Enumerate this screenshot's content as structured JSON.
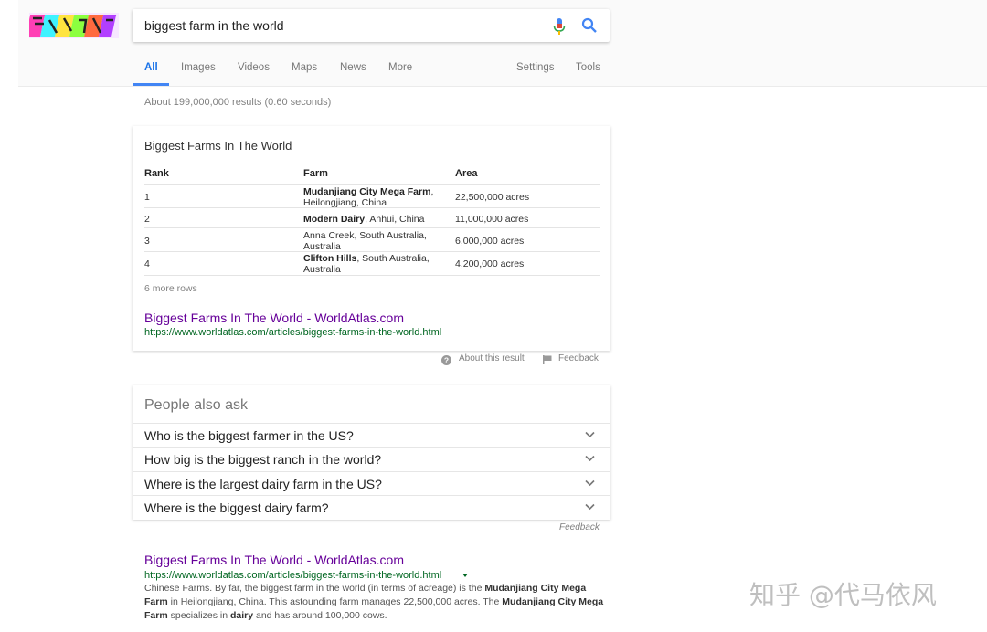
{
  "search": {
    "query": "biggest farm in the world"
  },
  "tabs": [
    {
      "label": "All"
    },
    {
      "label": "Images"
    },
    {
      "label": "Videos"
    },
    {
      "label": "Maps"
    },
    {
      "label": "News"
    },
    {
      "label": "More"
    },
    {
      "label": "Settings"
    },
    {
      "label": "Tools"
    }
  ],
  "stats": "About 199,000,000 results (0.60 seconds)",
  "snippet": {
    "title": "Biggest Farms In The World",
    "headers": [
      "Rank",
      "Farm",
      "Area"
    ],
    "rows": [
      {
        "rank": "1",
        "farm_bold": "Mudanjiang City Mega Farm",
        "farm_rest_1": ",",
        "farm_line2": "Heilongjiang, China",
        "area": "22,500,000 acres"
      },
      {
        "rank": "2",
        "farm_bold": "Modern Dairy",
        "farm_rest_1": ", Anhui, China",
        "farm_line2": "",
        "area": "11,000,000 acres"
      },
      {
        "rank": "3",
        "farm_bold": "",
        "farm_rest_1": "Anna Creek, South Australia,",
        "farm_line2": "Australia",
        "area": "6,000,000 acres"
      },
      {
        "rank": "4",
        "farm_bold": "Clifton Hills",
        "farm_rest_1": ", South Australia,",
        "farm_line2": "Australia",
        "area": "4,200,000 acres"
      }
    ],
    "more_rows": "6 more rows",
    "link_title": "Biggest Farms In The World - WorldAtlas.com",
    "link_url": "https://www.worldatlas.com/articles/biggest-farms-in-the-world.html",
    "about": "About this result",
    "feedback": "Feedback"
  },
  "paa": {
    "title": "People also ask",
    "questions": [
      "Who is the biggest farmer in the US?",
      "How big is the biggest ranch in the world?",
      "Where is the largest dairy farm in the US?",
      "Where is the biggest dairy farm?"
    ],
    "feedback": "Feedback"
  },
  "result": {
    "title": "Biggest Farms In The World - WorldAtlas.com",
    "url": "https://www.worldatlas.com/articles/biggest-farms-in-the-world.html",
    "d1": "Chinese Farms. By far, the biggest farm in the world (in terms of acreage) is the ",
    "d2": "Mudanjiang City Mega Farm",
    "d3": " in Heilongjiang, China. This astounding farm manages 22,500,000 acres. The ",
    "d4": "Mudanjiang City Mega Farm",
    "d5": " specializes in ",
    "d6": "dairy",
    "d7": " and has around 100,000 cows."
  },
  "watermark": "知乎 @代马依风",
  "colors": {
    "accent": "#4285f4",
    "link": "#660099",
    "url": "#006621"
  },
  "icons": {
    "mic": "mic-icon",
    "search": "search-icon",
    "help": "help-icon",
    "feedback": "flag-icon",
    "expand": "chevron-down-icon"
  }
}
